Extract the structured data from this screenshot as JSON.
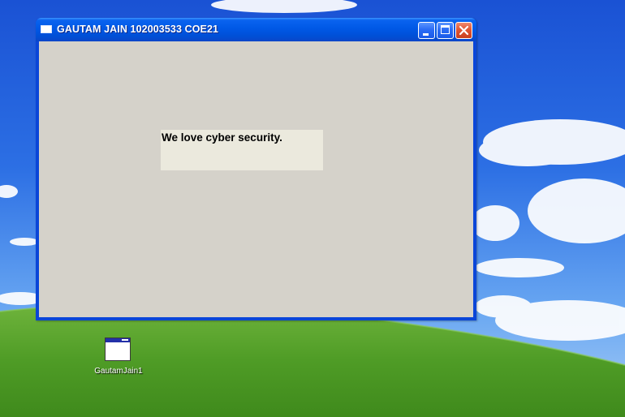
{
  "window": {
    "title": "GAUTAM JAIN 102003533 COE21",
    "label_text": "We love cyber security."
  },
  "desktop": {
    "icon_label": "GautamJain1"
  },
  "colors": {
    "titlebar": "#0058e6",
    "client_bg": "#d5d2ca",
    "label_bg": "#ebe9dd",
    "close_button": "#e05533"
  },
  "icons": {
    "window_icon": "app-window-icon",
    "minimize": "minimize-icon",
    "maximize": "maximize-icon",
    "close": "close-icon",
    "desktop_shortcut": "application-icon"
  }
}
